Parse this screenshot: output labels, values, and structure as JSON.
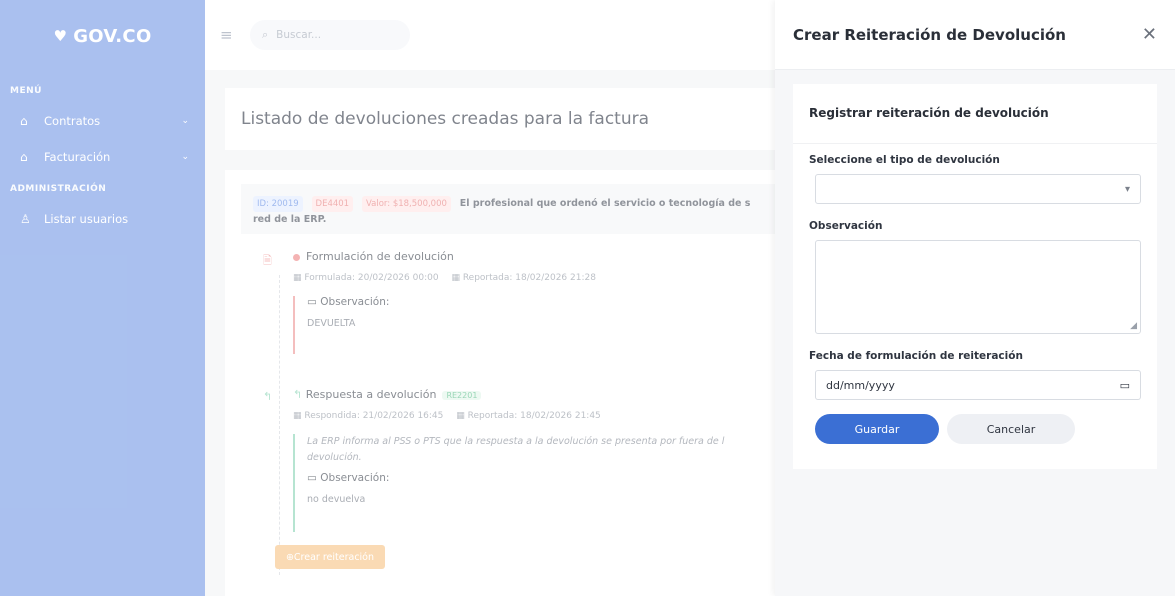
{
  "sidebar": {
    "logo": "GOV.CO",
    "logo_mark": "♥",
    "section_menu": "MENÚ",
    "items_menu": [
      {
        "label": "Contratos",
        "icon": "home-icon"
      },
      {
        "label": "Facturación",
        "icon": "home-icon"
      }
    ],
    "section_admin": "ADMINISTRACIÓN",
    "items_admin": [
      {
        "label": "Listar usuarios",
        "icon": "user-icon"
      }
    ]
  },
  "topbar": {
    "search_placeholder": "Buscar..."
  },
  "main": {
    "page_title": "Listado de devoluciones creadas para la factura",
    "invoice": {
      "id": "ID: 20019",
      "code": "DE4401",
      "value": "Valor: $18,500,000",
      "description": "El profesional que ordenó el servicio o tecnología de s",
      "description_cont": "red de la ERP."
    },
    "timeline": [
      {
        "title": "Formulación de devolución",
        "formulated": "Formulada: 20/02/2026 00:00",
        "reported": "Reportada: 18/02/2026 21:28",
        "obs_label": "Observación:",
        "obs_text": "DEVUELTA"
      },
      {
        "title": "Respuesta a devolución",
        "badge": "RE2201",
        "responded": "Respondida: 21/02/2026 16:45",
        "reported": "Reportada: 18/02/2026 21:45",
        "message": "La ERP informa al PSS o PTS que la respuesta a la devolución se presenta por fuera de l",
        "message_cont": "devolución.",
        "obs_label": "Observación:",
        "obs_text": "no devuelva"
      }
    ],
    "create_button": "Crear reiteración"
  },
  "drawer": {
    "title": "Crear Reiteración de Devolución",
    "form_title": "Registrar reiteración de devolución",
    "type_label": "Seleccione el tipo de devolución",
    "type_value": "",
    "obs_label": "Observación",
    "obs_value": "",
    "date_label": "Fecha de formulación de reiteración",
    "date_placeholder": "dd/mm/yyyy",
    "save_label": "Guardar",
    "cancel_label": "Cancelar"
  },
  "colors": {
    "sidebar_bg": "#7d9fe6",
    "primary_button": "#3b6fd4",
    "reiter_button": "#f8c78d"
  }
}
